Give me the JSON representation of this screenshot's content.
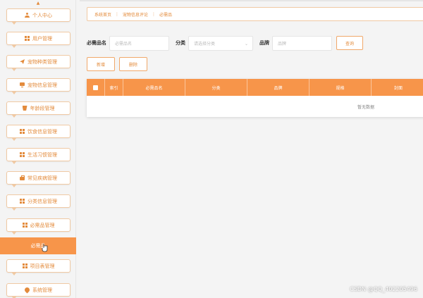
{
  "sidebar": {
    "items": [
      {
        "label": "个人中心",
        "icon": "user-icon"
      },
      {
        "label": "用户管理",
        "icon": "grid-icon"
      },
      {
        "label": "宠物种类管理",
        "icon": "send-icon"
      },
      {
        "label": "宠物信息管理",
        "icon": "monitor-icon"
      },
      {
        "label": "年龄段管理",
        "icon": "cup-icon"
      },
      {
        "label": "饮食信息管理",
        "icon": "grid-icon"
      },
      {
        "label": "生活习惯管理",
        "icon": "grid-icon"
      },
      {
        "label": "常见疾病管理",
        "icon": "briefcase-icon"
      },
      {
        "label": "分类信息管理",
        "icon": "grid-icon"
      },
      {
        "label": "必需品管理",
        "icon": "grid-icon"
      },
      {
        "label": "必需品",
        "icon": "",
        "active": true
      },
      {
        "label": "项目表管理",
        "icon": "grid-icon"
      },
      {
        "label": "系统管理",
        "icon": "pin-icon"
      }
    ]
  },
  "breadcrumb": {
    "home": "系统首页",
    "section": "宠物信息评论",
    "current": "必需品"
  },
  "search": {
    "name_label": "必需品名",
    "name_placeholder": "必需品名",
    "category_label": "分类",
    "category_placeholder": "请选择分类",
    "brand_label": "品牌",
    "brand_placeholder": "品牌",
    "search_button": "查询"
  },
  "actions": {
    "add_button": "新增",
    "delete_button": "删除"
  },
  "table": {
    "columns": [
      "索引",
      "必需品名",
      "分类",
      "品牌",
      "规格",
      "封面"
    ],
    "empty_text": "暂无数据"
  },
  "colors": {
    "accent": "#f7954a",
    "accent_text": "#e38b3c",
    "border": "#f0c9a3"
  },
  "watermark": "CSDN @QQ_402205496"
}
